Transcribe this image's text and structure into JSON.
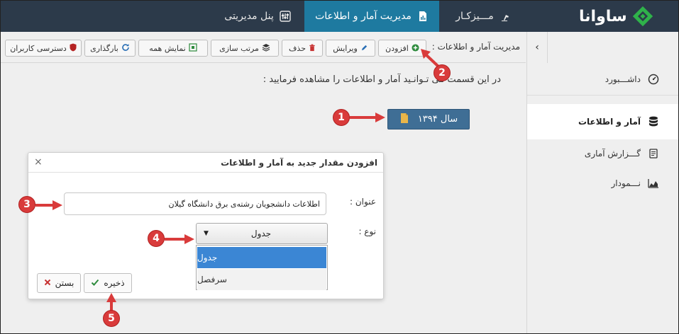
{
  "nav": {
    "logo": "ساوانا",
    "tabs": [
      {
        "label": "مـــیزکـار"
      },
      {
        "label": "مدیریت آمار و اطلاعات"
      },
      {
        "label": "پنل مدیریتی"
      }
    ]
  },
  "toolbar": {
    "title": "مدیریت آمار و اطلاعات :",
    "add_label": "افزودن",
    "edit_label": "ویرایش",
    "delete_label": "حذف",
    "sort_label": "مرتب سازی",
    "showall_label": "نمایش همه",
    "reload_label": "بارگذاری",
    "access_label": "دسترسی کاربران",
    "collapse": "‹"
  },
  "sidebar": {
    "items": [
      {
        "label": "داشـــبورد"
      },
      {
        "label": "آمار و اطلاعات"
      },
      {
        "label": "گـــزارش آماری"
      },
      {
        "label": "نـــمودار"
      }
    ]
  },
  "main": {
    "intro": "در این قسمت می تـوانـید آمار و اطلاعات را مشاهده فرمایید :",
    "year_label": "سال ۱۳۹۴"
  },
  "dialog": {
    "title": "افزودن مقدار جدید به آمار و اطلاعات",
    "close_glyph": "×",
    "title_label": "عنوان :",
    "title_value": "اطلاعات دانشجویان رشته‌ی برق دانشگاه گیلان",
    "type_label": "نوع :",
    "type_selected": "جدول",
    "type_options": [
      "جدول",
      "سرفصل"
    ],
    "save_label": "ذخیره",
    "close_label": "بستن"
  },
  "callouts": [
    "1",
    "2",
    "3",
    "4",
    "5"
  ],
  "colors": {
    "navbar": "#2c3a4a",
    "active_tab": "#1e7aa0",
    "year_button": "#3f6e95",
    "dropdown_highlight": "#3b86d4",
    "callout": "#d93b3b",
    "logo_green": "#2fb24a"
  }
}
